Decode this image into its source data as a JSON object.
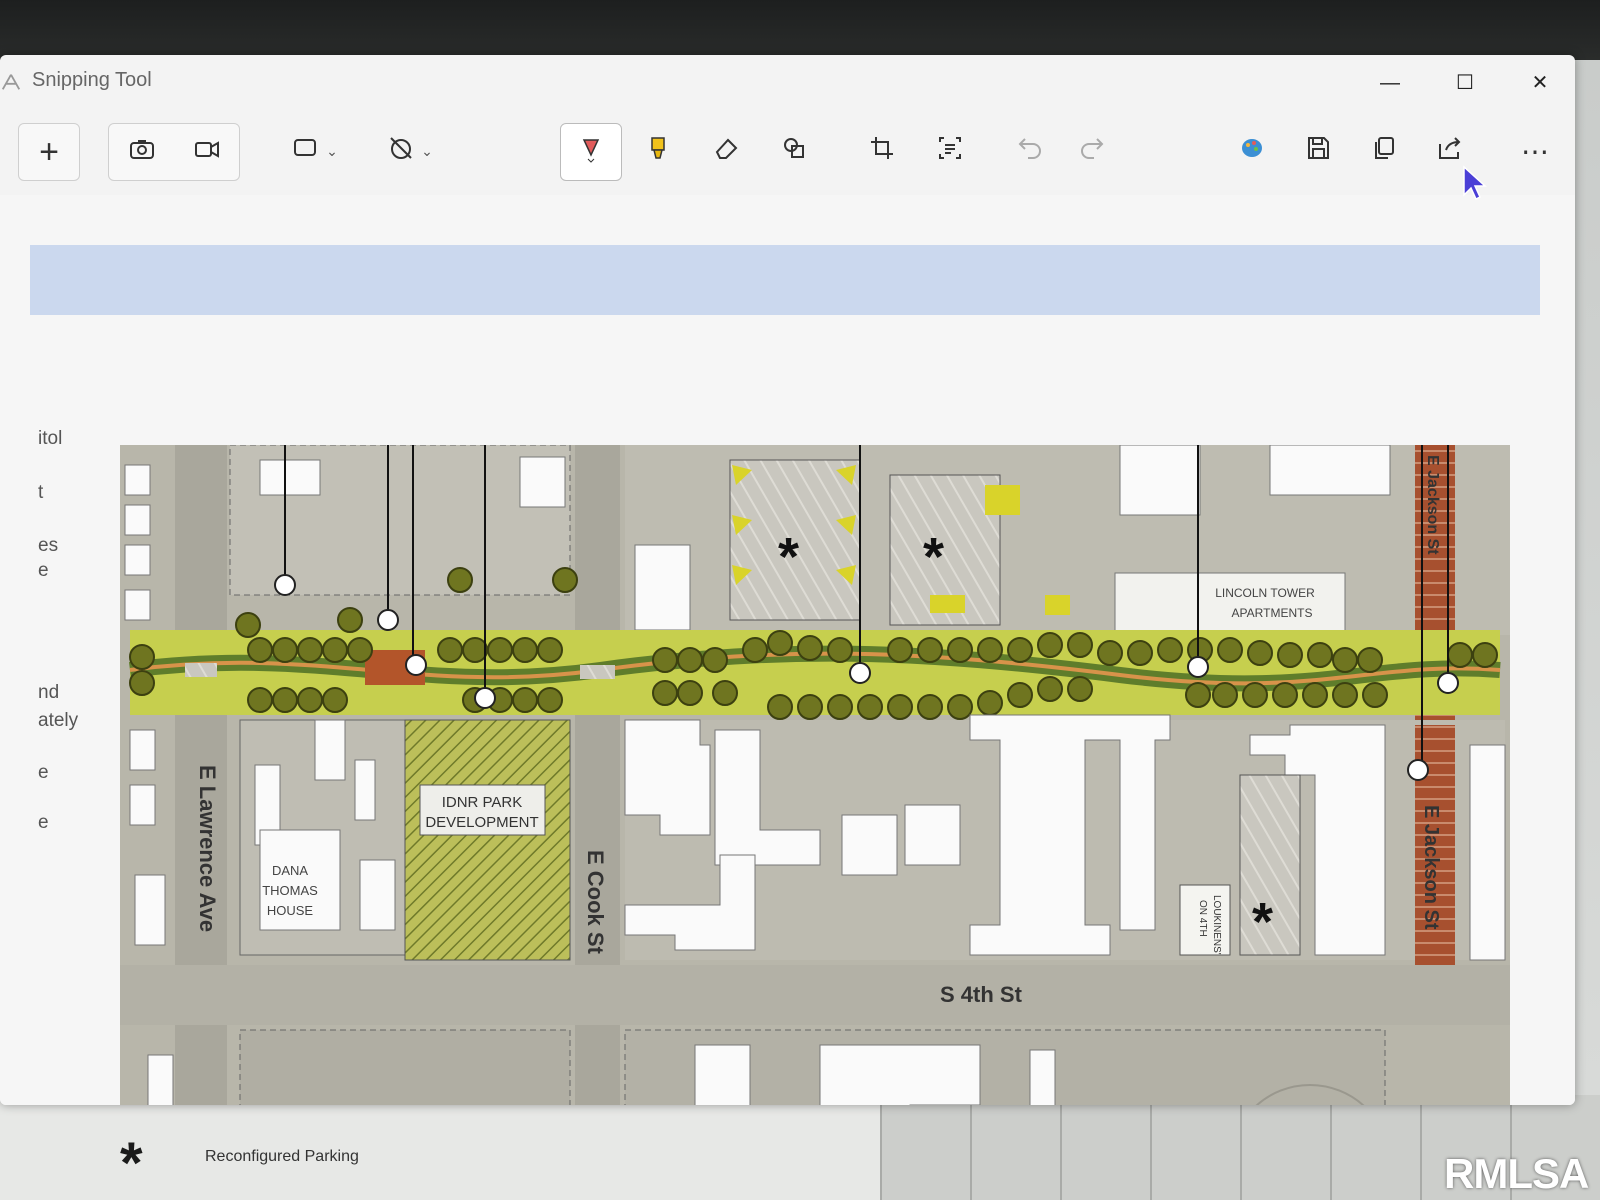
{
  "window": {
    "title": "Snipping Tool",
    "controls": {
      "minimize": "—",
      "maximize": "☐",
      "close": "✕"
    }
  },
  "toolbar": {
    "new": "+",
    "more": "⋯"
  },
  "side_text": [
    "itol",
    "t",
    "es",
    "e",
    "nd",
    "ately",
    "e",
    "e"
  ],
  "map": {
    "streets": {
      "lawrence": "E Lawrence Ave",
      "cook": "E Cook St",
      "jackson": "E Jackson St",
      "jackson_top": "E Jackson St",
      "fourth": "S 4th St"
    },
    "labels": {
      "idnr": [
        "IDNR PARK",
        "DEVELOPMENT"
      ],
      "dana": [
        "DANA",
        "THOMAS",
        "HOUSE"
      ],
      "lincoln": [
        "LINCOLN TOWER",
        "APARTMENTS"
      ],
      "loukinens": [
        "LOUKINENS'",
        "ON 4TH"
      ]
    },
    "parking_marker": "*"
  },
  "legend": {
    "symbol": "*",
    "label": "Reconfigured Parking"
  },
  "watermark": "RMLSA"
}
